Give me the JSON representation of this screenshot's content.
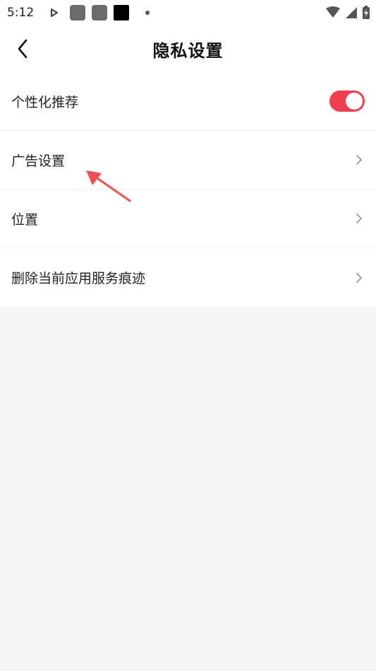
{
  "status_bar": {
    "time": "5:12",
    "icons": [
      "play-icon",
      "app-icon",
      "app-icon",
      "app-icon-black",
      "dot-icon"
    ],
    "right_icons": [
      "wifi-icon",
      "signal-icon",
      "battery-charging-icon"
    ]
  },
  "header": {
    "title": "隐私设置",
    "back_icon": "chevron-left-icon"
  },
  "settings": {
    "personalized": {
      "label": "个性化推荐",
      "toggle_on": true,
      "toggle_color": "#f23d4f"
    },
    "ad_settings": {
      "label": "广告设置"
    },
    "location": {
      "label": "位置"
    },
    "delete_traces": {
      "label": "删除当前应用服务痕迹"
    }
  },
  "annotation": {
    "color": "#ef4f4f",
    "icon": "red-arrow-annotation"
  }
}
